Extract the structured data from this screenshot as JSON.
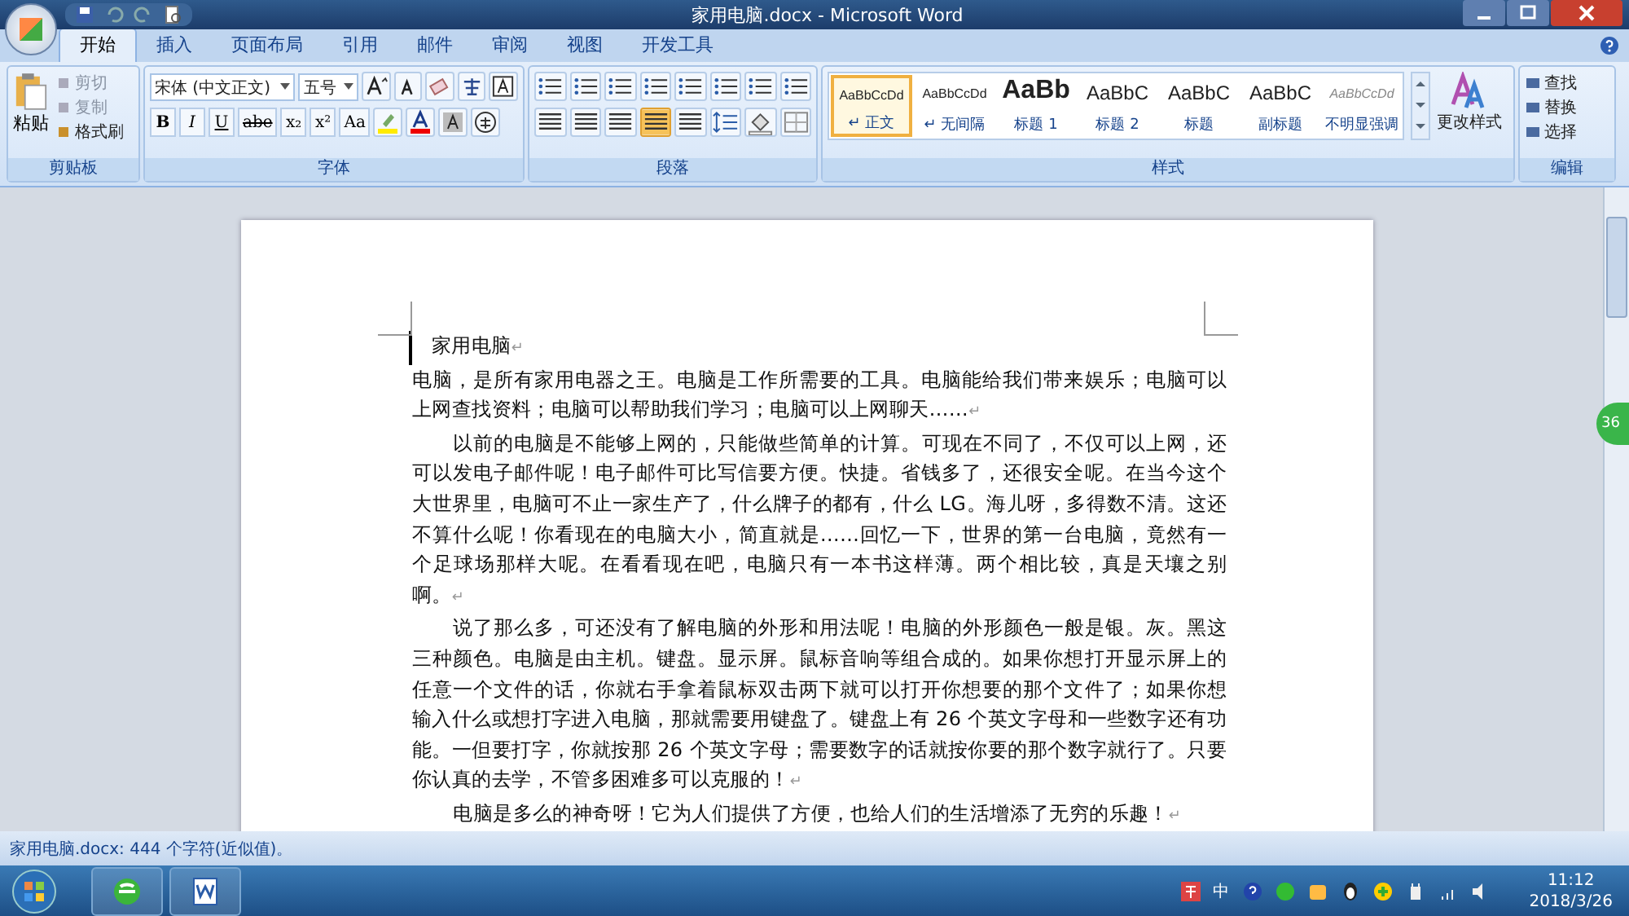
{
  "title_bar": {
    "title": "家用电脑.docx - Microsoft Word"
  },
  "tabs": [
    {
      "label": "开始",
      "selected": true
    },
    {
      "label": "插入",
      "selected": false
    },
    {
      "label": "页面布局",
      "selected": false
    },
    {
      "label": "引用",
      "selected": false
    },
    {
      "label": "邮件",
      "selected": false
    },
    {
      "label": "审阅",
      "selected": false
    },
    {
      "label": "视图",
      "selected": false
    },
    {
      "label": "开发工具",
      "selected": false
    }
  ],
  "clipboard": {
    "label": "剪贴板",
    "paste": "粘贴",
    "items": [
      {
        "label": "剪切",
        "disabled": true
      },
      {
        "label": "复制",
        "disabled": true
      },
      {
        "label": "格式刷",
        "disabled": false
      }
    ]
  },
  "font": {
    "label": "字体",
    "font_name": "宋体 (中文正文)",
    "font_size": "五号",
    "format_buttons": [
      "B",
      "I",
      "U",
      "abe",
      "x₂",
      "x²",
      "Aa"
    ]
  },
  "paragraph": {
    "label": "段落",
    "alignments": [
      {
        "selected": false
      },
      {
        "selected": false
      },
      {
        "selected": false
      },
      {
        "selected": true
      },
      {
        "selected": false
      }
    ]
  },
  "styles": {
    "label": "样式",
    "change_styles": "更改样式",
    "items": [
      {
        "preview": "AaBbCcDd",
        "label": "↵ 正文",
        "kind": "normal",
        "selected": true
      },
      {
        "preview": "AaBbCcDd",
        "label": "↵ 无间隔",
        "kind": "normal",
        "selected": false
      },
      {
        "preview": "AaBb",
        "label": "标题 1",
        "kind": "heading",
        "selected": false
      },
      {
        "preview": "AaBbC",
        "label": "标题 2",
        "kind": "subheading",
        "selected": false
      },
      {
        "preview": "AaBbC",
        "label": "标题",
        "kind": "subheading",
        "selected": false
      },
      {
        "preview": "AaBbC",
        "label": "副标题",
        "kind": "subheading",
        "selected": false
      },
      {
        "preview": "AaBbCcDd",
        "label": "不明显强调",
        "kind": "subtle",
        "selected": false
      }
    ]
  },
  "editing": {
    "label": "编辑",
    "items": [
      "查找",
      "替换",
      "选择"
    ]
  },
  "document": {
    "paragraphs": [
      {
        "kind": "title",
        "text": "家用电脑",
        "end_mark": "↵"
      },
      {
        "kind": "plain",
        "text": "电脑，是所有家用电器之王。电脑是工作所需要的工具。电脑能给我们带来娱乐；电脑可以上网查找资料；电脑可以帮助我们学习；电脑可以上网聊天……",
        "end_mark": "↵"
      },
      {
        "kind": "indented",
        "text": "以前的电脑是不能够上网的，只能做些简单的计算。可现在不同了，不仅可以上网，还可以发电子邮件呢！电子邮件可比写信要方便。快捷。省钱多了，还很安全呢。在当今这个大世界里，电脑可不止一家生产了，什么牌子的都有，什么 LG。海儿呀，多得数不清。这还不算什么呢！你看现在的电脑大小，简直就是……回忆一下，世界的第一台电脑，竟然有一个足球场那样大呢。在看看现在吧，电脑只有一本书这样薄。两个相比较，真是天壤之别啊。",
        "end_mark": "↵"
      },
      {
        "kind": "indented",
        "text": "说了那么多，可还没有了解电脑的外形和用法呢！电脑的外形颜色一般是银。灰。黑这三种颜色。电脑是由主机。键盘。显示屏。鼠标音响等组合成的。如果你想打开显示屏上的任意一个文件的话，你就右手拿着鼠标双击两下就可以打开你想要的那个文件了；如果你想输入什么或想打字进入电脑，那就需要用键盘了。键盘上有 26 个英文字母和一些数字还有功能。一但要打字，你就按那 26 个英文字母；需要数字的话就按你要的那个数字就行了。只要你认真的去学，不管多困难多可以克服的！",
        "end_mark": "↵"
      },
      {
        "kind": "indented",
        "text": "电脑是多么的神奇呀！它为人们提供了方便，也给人们的生活增添了无穷的乐趣！",
        "end_mark": "↵"
      }
    ]
  },
  "side_badge": "36",
  "status_bar": {
    "text": "家用电脑.docx: 444 个字符(近似值)。"
  },
  "taskbar": {
    "ime": "中",
    "time": "11:12",
    "date": "2018/3/26"
  }
}
